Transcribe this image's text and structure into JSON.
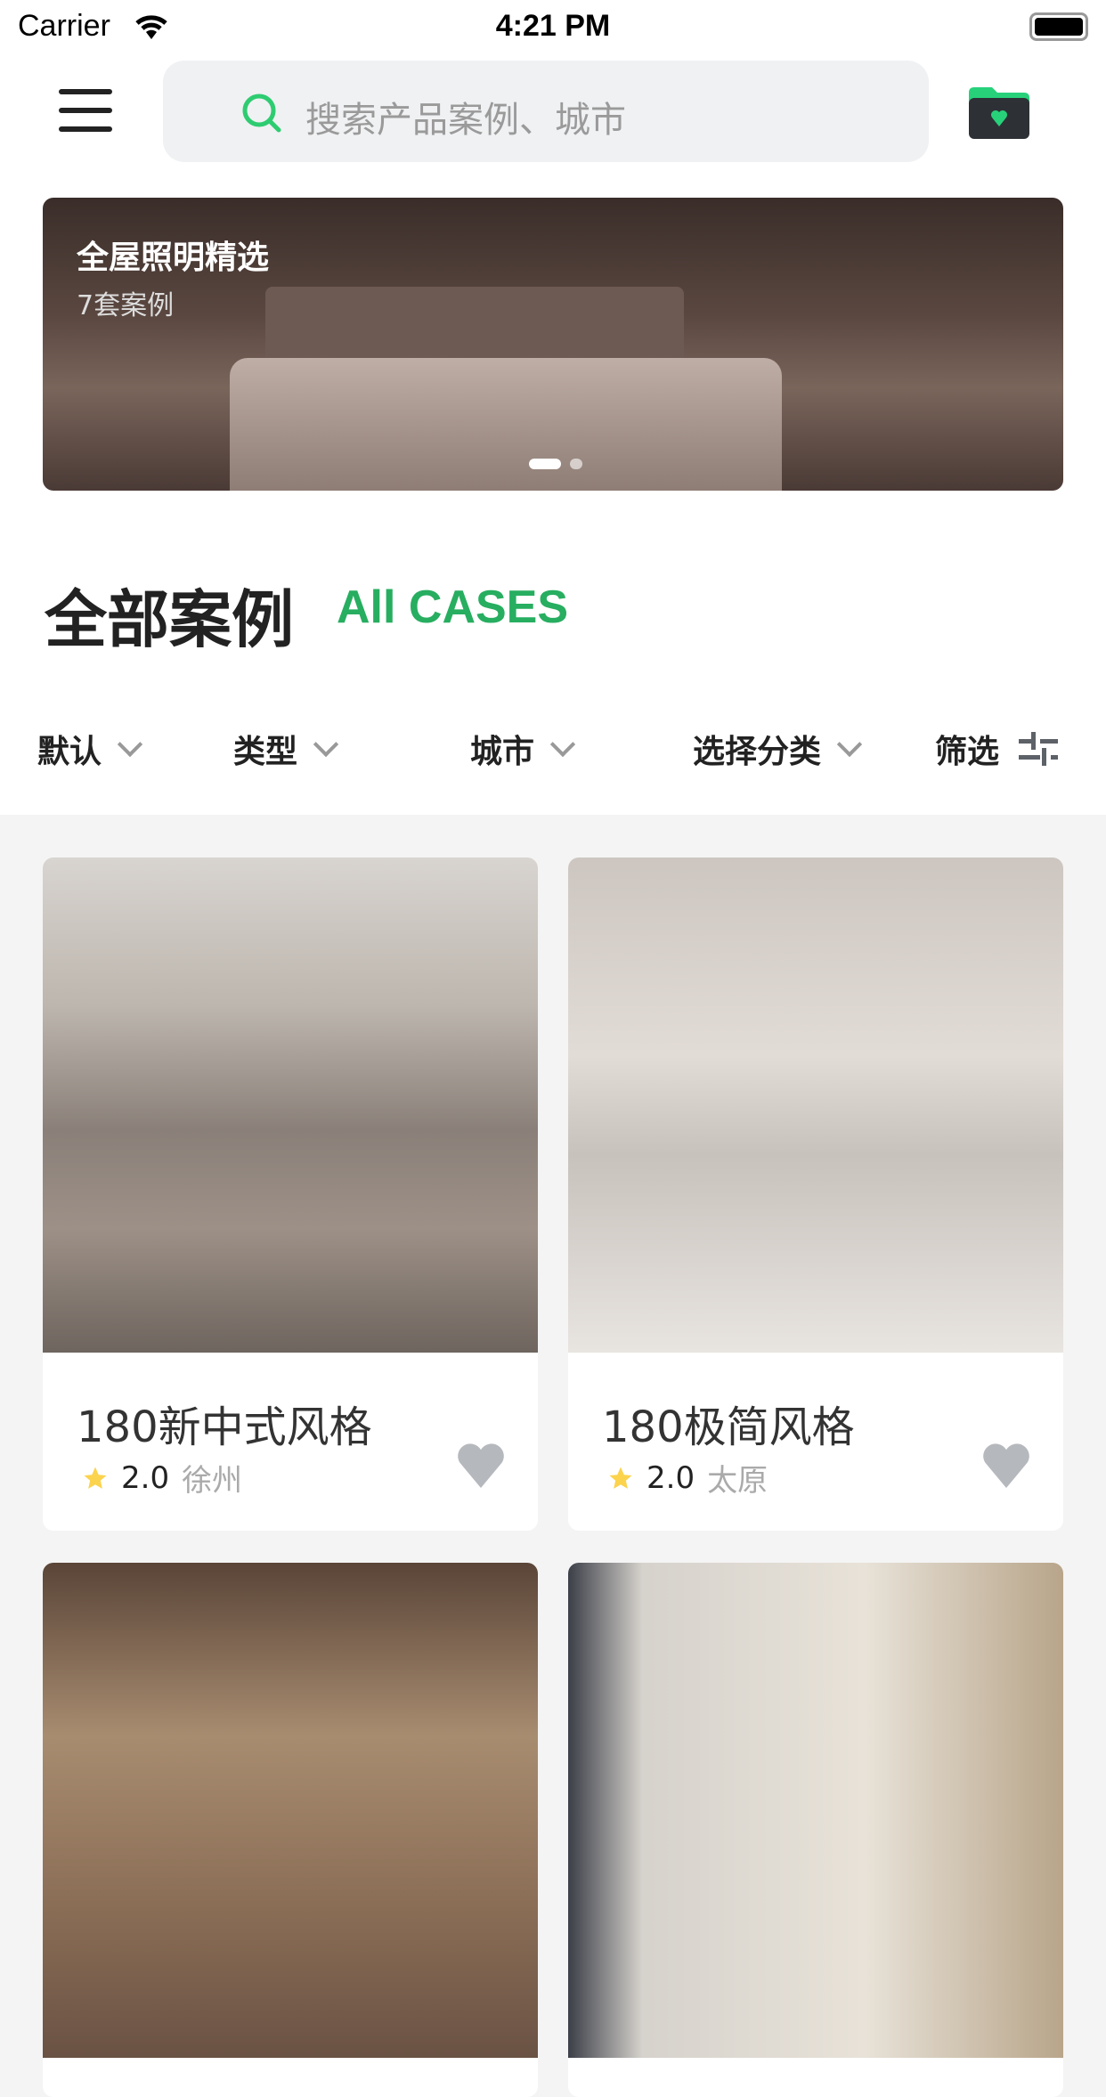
{
  "status_bar": {
    "carrier": "Carrier",
    "time": "4:21 PM"
  },
  "header": {
    "search_placeholder": "搜索产品案例、城市",
    "menu_icon": "hamburger-icon",
    "favorites_icon": "folder-heart-icon"
  },
  "banner": {
    "title": "全屋照明精选",
    "subtitle": "7套案例",
    "page_count": 2,
    "active_page": 1
  },
  "section": {
    "title": "全部案例",
    "subtitle": "All CASES"
  },
  "filters": [
    {
      "label": "默认"
    },
    {
      "label": "类型"
    },
    {
      "label": "城市"
    },
    {
      "label": "选择分类"
    },
    {
      "label": "筛选"
    }
  ],
  "colors": {
    "accent": "#27ae60",
    "star": "#fbd34d",
    "heart": "#b5b8bd"
  },
  "cases": [
    {
      "title": "180新中式风格",
      "rating": "2.0",
      "city": "徐州"
    },
    {
      "title": "180极简风格",
      "rating": "2.0",
      "city": "太原"
    },
    {
      "title": "",
      "rating": "",
      "city": ""
    },
    {
      "title": "",
      "rating": "",
      "city": ""
    }
  ]
}
